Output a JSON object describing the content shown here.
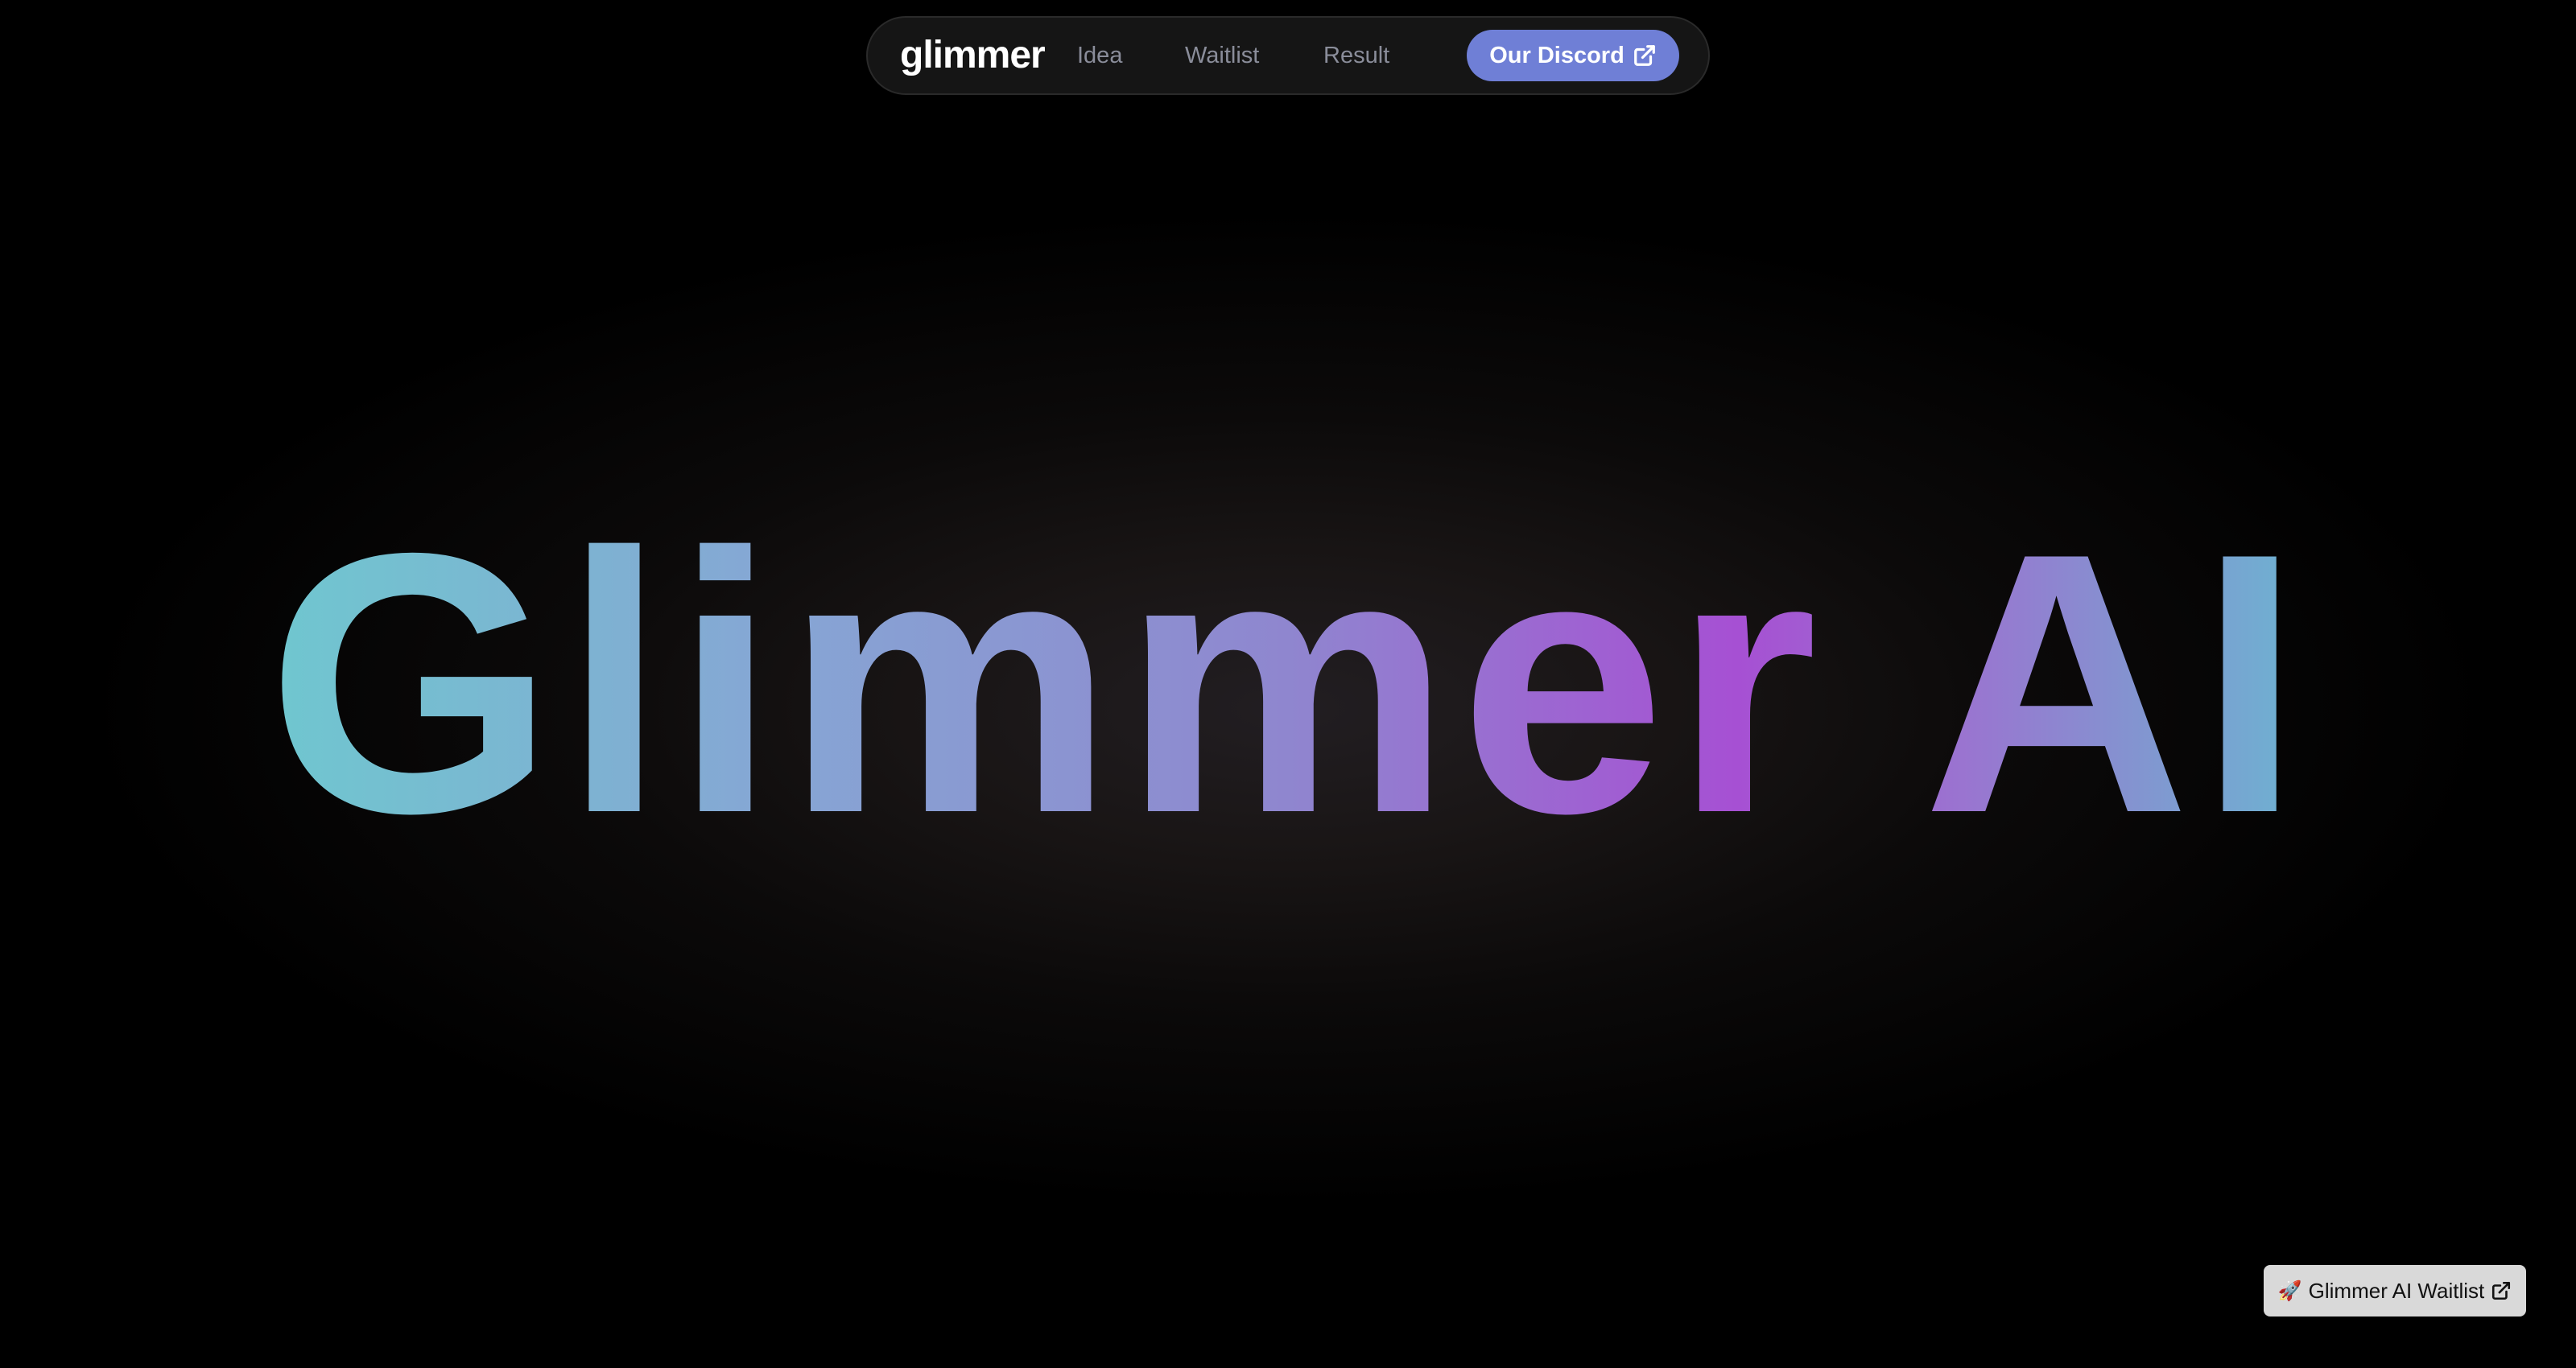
{
  "nav": {
    "brand": "glimmer",
    "links": [
      {
        "label": "Idea"
      },
      {
        "label": "Waitlist"
      },
      {
        "label": "Result"
      }
    ],
    "cta": {
      "label": "Our Discord",
      "icon": "external-link-icon",
      "color": "#6f7fd6"
    }
  },
  "hero": {
    "title": "Glimmer AI",
    "gradient_colors": [
      "#6fc7cf",
      "#8f86cf",
      "#a650d3",
      "#6cb4d1"
    ]
  },
  "floating_badge": {
    "icon": "rocket-icon",
    "icon_glyph": "🚀",
    "label": "Glimmer AI Waitlist",
    "trailing_icon": "external-link-icon"
  },
  "colors": {
    "background": "#000000",
    "nav_background": "#151515",
    "nav_link": "#8a8d9a",
    "badge_background": "#d9d9d9"
  }
}
